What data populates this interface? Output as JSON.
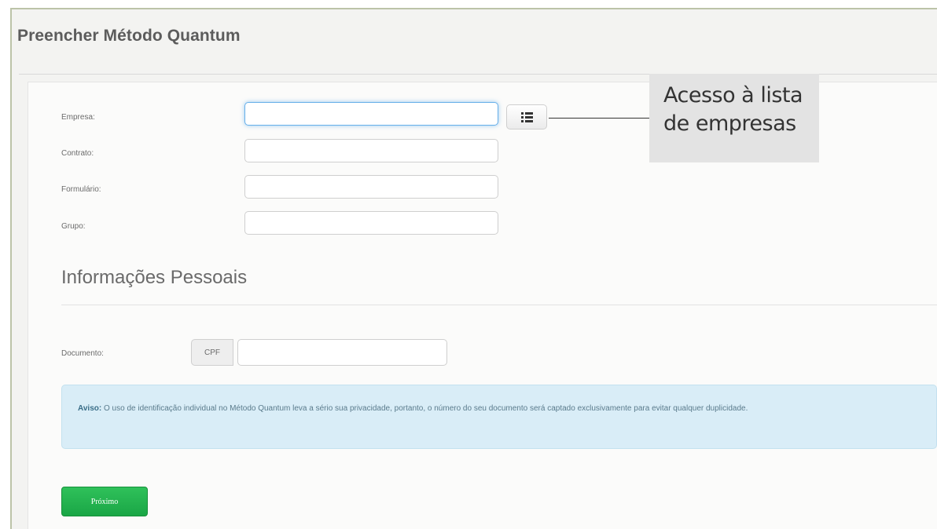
{
  "page": {
    "title": "Preencher Método Quantum"
  },
  "form": {
    "fields": [
      {
        "label": "Empresa:",
        "value": "",
        "focused": true
      },
      {
        "label": "Contrato:",
        "value": ""
      },
      {
        "label": "Formulário:",
        "value": ""
      },
      {
        "label": "Grupo:",
        "value": ""
      }
    ],
    "list_button_icon": "list-icon"
  },
  "callout": {
    "line1": "Acesso à lista",
    "line2": "de empresas"
  },
  "personal": {
    "title": "Informações Pessoais",
    "document_label": "Documento:",
    "document_prefix": "CPF",
    "document_value": ""
  },
  "notice": {
    "bold": "Aviso:",
    "text": "O uso de identificação individual no Método Quantum leva a sério sua privacidade, portanto, o número do seu documento será captado exclusivamente para evitar qualquer duplicidade."
  },
  "actions": {
    "next_label": "Próximo"
  },
  "colors": {
    "focus_border": "#66afe9",
    "alert_bg": "#d9edf7",
    "primary_green": "#1aa646"
  }
}
